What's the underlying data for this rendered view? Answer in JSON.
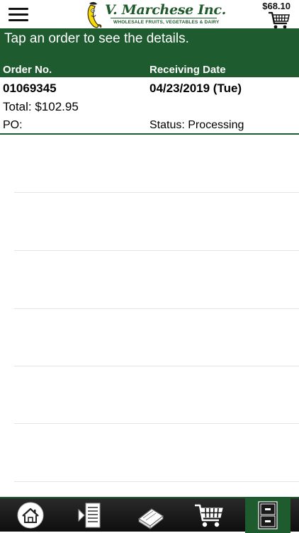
{
  "header": {
    "logo_name": "V. Marchese Inc.",
    "logo_tagline": "WHOLESALE FRUITS, VEGETABLES & DAIRY",
    "cart_total": "$68.10",
    "menu_icon": "hamburger-menu-icon",
    "cart_icon": "shopping-cart-icon"
  },
  "banner": {
    "text": "Tap an order to see the details."
  },
  "columns": {
    "order_no": "Order No.",
    "receiving_date": "Receiving Date"
  },
  "orders": [
    {
      "order_no": "01069345",
      "receiving_date": "04/23/2019 (Tue)",
      "total": "Total: $102.95",
      "po": "PO:",
      "status": "Status: Processing"
    }
  ],
  "tabbar": {
    "tabs": [
      {
        "icon": "home-icon"
      },
      {
        "icon": "order-guide-icon"
      },
      {
        "icon": "catalog-book-icon"
      },
      {
        "icon": "cart-icon"
      },
      {
        "icon": "orders-cabinet-icon",
        "active": true
      }
    ]
  },
  "colors": {
    "brand_green": "#1e5b2e",
    "tabbar_bg": "#1a1a1a"
  }
}
